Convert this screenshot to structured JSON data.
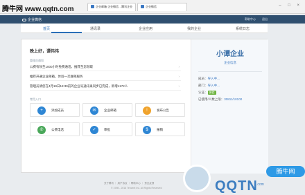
{
  "watermark": {
    "site": "腾牛网 www.qqtn.com",
    "big": "QQTN",
    "pill": "腾牛网",
    "small": ".com"
  },
  "browser": {
    "tabs": [
      {
        "label": "企业邮箱 企业微信…腾讯企业"
      },
      {
        "label": "企业微信"
      }
    ],
    "window_buttons": "– □ ×"
  },
  "app": {
    "logo": "企业微信",
    "top_links": [
      "帮助中心",
      "退出"
    ]
  },
  "nav": [
    "首页",
    "通讯录",
    "企业应用",
    "我的企业",
    "系统日志"
  ],
  "main": {
    "greeting": "晚上好，谭伟伟",
    "notices_title": "管理员通知",
    "notices": [
      "公费有效至1000小时免费通话，推荐至您领取",
      "推荐开通企业邮箱，体验一次群邮服务",
      "管理员请您在4月19日18:39前的企业号通讯录同步已完成，新增4172人"
    ],
    "shortcuts_title": "常用入口",
    "shortcuts": [
      {
        "label": "添加成员",
        "icon": "add-member-icon",
        "color": "#2e86d4"
      },
      {
        "label": "企业邮箱",
        "icon": "mail-icon",
        "color": "#2e86d4"
      },
      {
        "label": "发布公告",
        "icon": "announcement-icon",
        "color": "#f0a32c"
      },
      {
        "label": "公费电话",
        "icon": "phone-icon",
        "color": "#4aa85a"
      },
      {
        "label": "审批",
        "icon": "approval-icon",
        "color": "#2e86d4"
      },
      {
        "label": "报销",
        "icon": "reimburse-icon",
        "color": "#2e86d4"
      }
    ]
  },
  "sidebar": {
    "name": "小谭企业",
    "link": "企业信息",
    "rows": [
      {
        "label": "成员：",
        "value": "导入中…"
      },
      {
        "label": "部门：",
        "value": "导入中…"
      },
      {
        "label": "认证：",
        "value": "体验"
      },
      {
        "label": "已使用/人数上限：",
        "value": "30811/10100"
      }
    ]
  },
  "footer": {
    "links": "关于腾讯 ｜ 用户协议 ｜ 帮助中心 ｜ 意见反馈",
    "copyright": "© 1998 - 2016 Tencent Inc. All Rights Reserved"
  },
  "colors": {
    "accent": "#2a6fb8",
    "header_bg": "#2f4f6f"
  }
}
